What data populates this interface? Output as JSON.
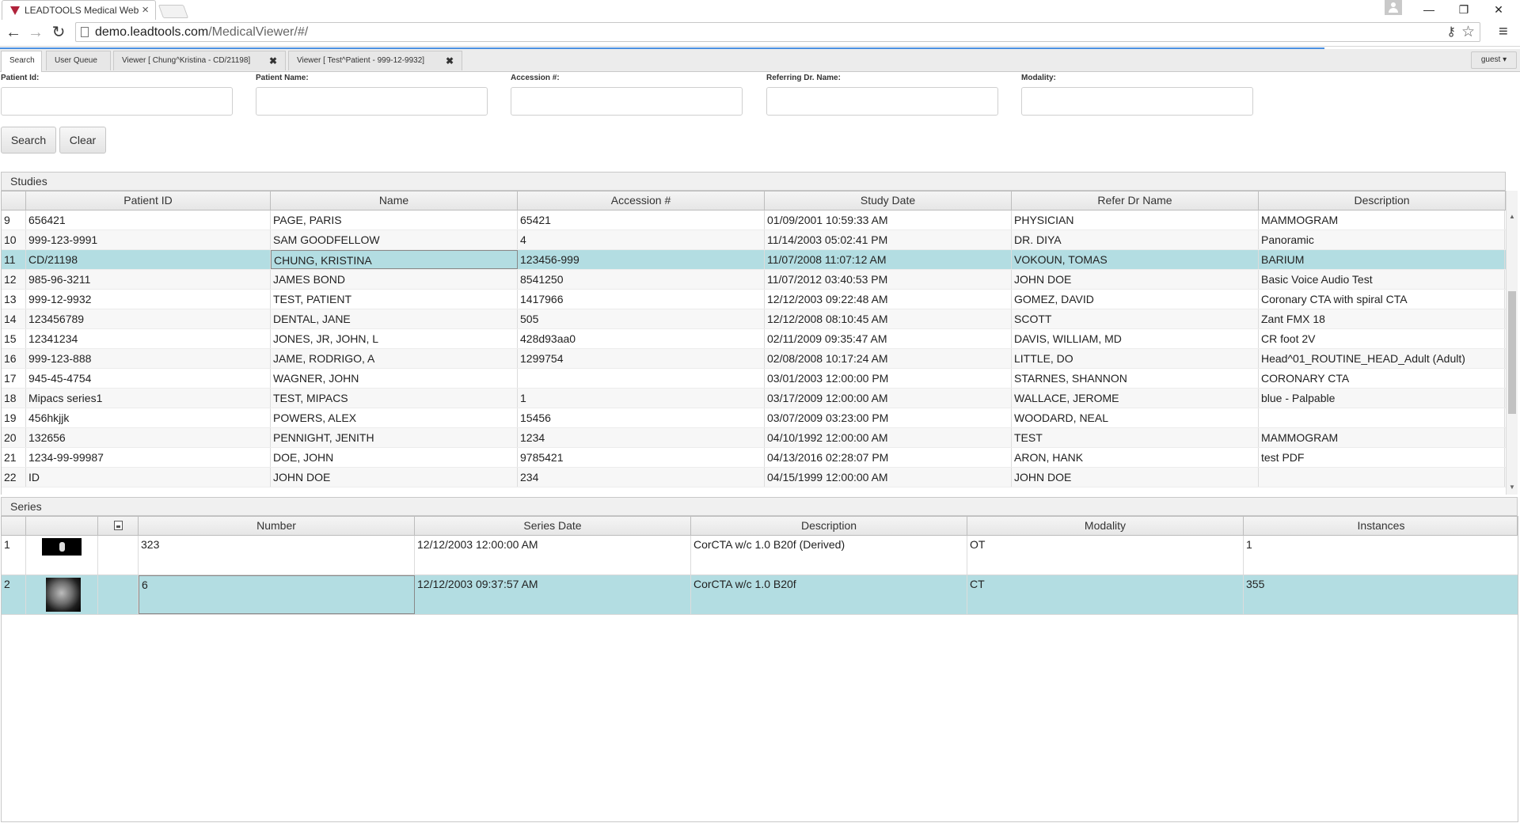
{
  "browser": {
    "tab_title": "LEADTOOLS Medical Web",
    "tab_close": "×",
    "url_host": "demo.leadtools.com",
    "url_path": "/MedicalViewer/#/",
    "back_glyph": "←",
    "forward_glyph": "→",
    "reload_glyph": "↻",
    "minimize_glyph": "—",
    "restore_glyph": "❐",
    "close_glyph": "✕",
    "menu_glyph": "≡",
    "star_glyph": "☆",
    "key_glyph": "⚷"
  },
  "app_tabs": [
    {
      "label": "Search"
    },
    {
      "label": "User Queue"
    },
    {
      "label": "Viewer [ Chung^Kristina - CD/21198]",
      "close": "✖"
    },
    {
      "label": "Viewer [ Test^Patient - 999-12-9932]",
      "close": "✖"
    }
  ],
  "user_menu": {
    "label": "guest ▾"
  },
  "search_form": {
    "labels": {
      "patient_id": "Patient Id:",
      "patient_name": "Patient Name:",
      "accession": "Accession #:",
      "referring_dr": "Referring Dr. Name:",
      "modality": "Modality:"
    },
    "values": {
      "patient_id": "",
      "patient_name": "",
      "accession": "",
      "referring_dr": "",
      "modality": ""
    },
    "search_button": "Search",
    "clear_button": "Clear"
  },
  "studies": {
    "title": "Studies",
    "columns": [
      "",
      "Patient ID",
      "Name",
      "Accession #",
      "Study Date",
      "Refer Dr Name",
      "Description"
    ],
    "selected_row": 2,
    "rows": [
      [
        "9",
        "656421",
        "PAGE, PARIS",
        "65421",
        "01/09/2001 10:59:33 AM",
        "PHYSICIAN",
        "MAMMOGRAM"
      ],
      [
        "10",
        "999-123-9991",
        "SAM GOODFELLOW",
        "4",
        "11/14/2003 05:02:41 PM",
        "DR. DIYA",
        "Panoramic"
      ],
      [
        "11",
        "CD/21198",
        "CHUNG, KRISTINA",
        "123456-999",
        "11/07/2008 11:07:12 AM",
        "VOKOUN, TOMAS",
        "BARIUM"
      ],
      [
        "12",
        "985-96-3211",
        "JAMES BOND",
        "8541250",
        "11/07/2012 03:40:53 PM",
        "JOHN DOE",
        "Basic Voice Audio Test"
      ],
      [
        "13",
        "999-12-9932",
        "TEST, PATIENT",
        "1417966",
        "12/12/2003 09:22:48 AM",
        "GOMEZ, DAVID",
        "Coronary CTA with spiral CTA"
      ],
      [
        "14",
        "123456789",
        "DENTAL, JANE",
        "505",
        "12/12/2008 08:10:45 AM",
        "SCOTT",
        "Zant FMX 18"
      ],
      [
        "15",
        "12341234",
        "JONES, JR, JOHN, L",
        "428d93aa0",
        "02/11/2009 09:35:47 AM",
        "DAVIS, WILLIAM, MD",
        "CR foot 2V"
      ],
      [
        "16",
        "999-123-888",
        "JAME, RODRIGO, A",
        "1299754",
        "02/08/2008 10:17:24 AM",
        "LITTLE, DO",
        "Head^01_ROUTINE_HEAD_Adult (Adult)"
      ],
      [
        "17",
        "945-45-4754",
        "WAGNER, JOHN",
        "",
        "03/01/2003 12:00:00 PM",
        "STARNES, SHANNON",
        "CORONARY CTA"
      ],
      [
        "18",
        "Mipacs series1",
        "TEST, MIPACS",
        "1",
        "03/17/2009 12:00:00 AM",
        "WALLACE, JEROME",
        "blue - Palpable"
      ],
      [
        "19",
        "456hkjjk",
        "POWERS, ALEX",
        "15456",
        "03/07/2009 03:23:00 PM",
        "WOODARD, NEAL",
        ""
      ],
      [
        "20",
        "132656",
        "PENNIGHT, JENITH",
        "1234",
        "04/10/1992 12:00:00 AM",
        "TEST",
        "MAMMOGRAM"
      ],
      [
        "21",
        "1234-99-99987",
        "DOE, JOHN",
        "9785421",
        "04/13/2016 02:28:07 PM",
        "ARON, HANK",
        "test PDF"
      ],
      [
        "22",
        "ID",
        "JOHN DOE",
        "234",
        "04/15/1999 12:00:00 AM",
        "JOHN DOE",
        ""
      ]
    ]
  },
  "series": {
    "title": "Series",
    "columns": [
      "",
      "",
      "",
      "Number",
      "Series Date",
      "Description",
      "Modality",
      "Instances"
    ],
    "selected_row": 1,
    "rows": [
      [
        "1",
        "323",
        "12/12/2003 12:00:00 AM",
        "CorCTA w/c 1.0 B20f (Derived)",
        "OT",
        "1"
      ],
      [
        "2",
        "6",
        "12/12/2003 09:37:57 AM",
        "CorCTA w/c 1.0 B20f",
        "CT",
        "355"
      ]
    ]
  }
}
